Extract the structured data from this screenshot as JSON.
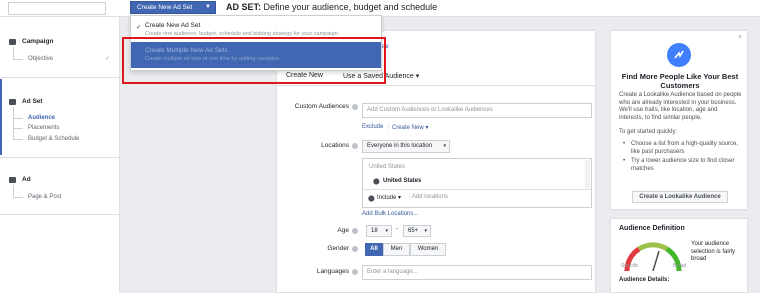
{
  "topbar": {
    "mode_button": "Create New Ad Set",
    "title_bold": "AD SET:",
    "title_rest": " Define your audience, budget and schedule"
  },
  "dropdown": {
    "items": [
      {
        "title": "Create New Ad Set",
        "subtitle": "Create one audience, budget, schedule and bidding strategy for your campaign.",
        "checked": true
      },
      {
        "title": "Create Multiple New Ad Sets",
        "subtitle": "Create multiple ad sets at one time by adding variables.",
        "checked": false
      }
    ]
  },
  "sidebar": {
    "campaign": {
      "label": "Campaign",
      "items": [
        "Objective"
      ]
    },
    "adset": {
      "label": "Ad Set",
      "items": [
        "Audience",
        "Placements",
        "Budget & Schedule"
      ],
      "active": "Audience"
    },
    "ad": {
      "label": "Ad",
      "items": [
        "Page & Post"
      ]
    }
  },
  "main": {
    "learn_more": "rn more",
    "tabs": {
      "create_new": "Create New",
      "saved": "Use a Saved Audience"
    },
    "custom_audiences": {
      "label": "Custom Audiences",
      "placeholder": "Add Custom Audiences or Lookalike Audiences",
      "exclude": "Exclude",
      "create_new": "Create New"
    },
    "locations": {
      "label": "Locations",
      "mode": "Everyone in this location",
      "header": "United States",
      "selected": "United States",
      "include": "Include",
      "placeholder": "Add locations",
      "bulk": "Add Bulk Locations..."
    },
    "age": {
      "label": "Age",
      "min": "18",
      "max": "65+",
      "dash": "-"
    },
    "gender": {
      "label": "Gender",
      "options": [
        "All",
        "Men",
        "Women"
      ],
      "selected": "All"
    },
    "languages": {
      "label": "Languages",
      "placeholder": "Enter a language..."
    }
  },
  "right_panel": {
    "close": "×",
    "title": "Find More People Like Your Best Customers",
    "body": "Create a Lookalike Audience based on people who are already interested in your business. We'll use traits, like location, age and interests, to find similar people.",
    "tip_header": "To get started quickly:",
    "bullets": [
      "Choose a list from a high-quality source, like past purchasers",
      "Try a lower audience size to find closer matches"
    ],
    "button": "Create a Lookalike Audience",
    "definition": {
      "title": "Audience Definition",
      "text": "Your audience selection is fairly broad",
      "specific": "Specific",
      "broad": "Broad",
      "details": "Audience Details:"
    }
  }
}
